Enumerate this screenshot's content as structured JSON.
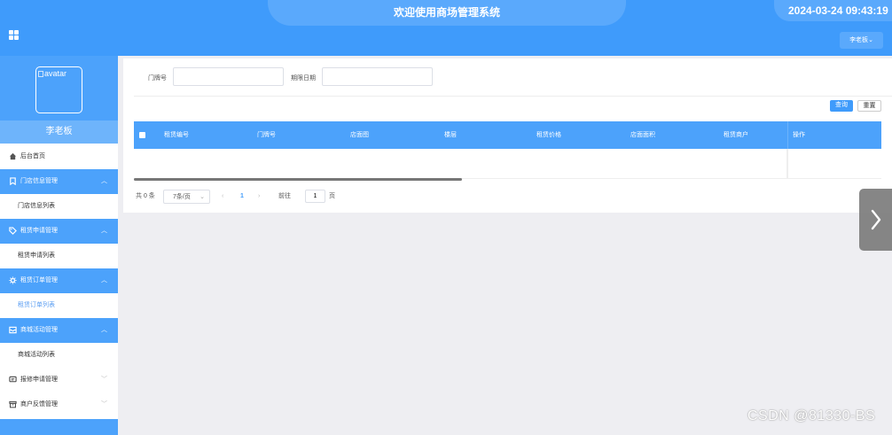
{
  "header": {
    "title": "欢迎使用商场管理系统",
    "datetime": "2024-03-24 09:43:19",
    "user_button_label": "李老板"
  },
  "sidebar": {
    "avatar_alt": "avatar",
    "username": "李老板",
    "items": [
      {
        "label": "后台首页",
        "icon": "home-icon"
      },
      {
        "label": "门店信息管理",
        "icon": "bookmark-icon",
        "expanded": true,
        "children": [
          "门店信息列表"
        ]
      },
      {
        "label": "租赁申请管理",
        "icon": "tag-icon",
        "expanded": true,
        "children": [
          "租赁申请列表"
        ]
      },
      {
        "label": "租赁订单管理",
        "icon": "gear-icon",
        "expanded": true,
        "children": [
          "租赁订单列表"
        ]
      },
      {
        "label": "商城活动管理",
        "icon": "inbox-icon",
        "expanded": true,
        "children": [
          "商城活动列表"
        ]
      },
      {
        "label": "报修申请管理",
        "icon": "message-icon",
        "expanded": false
      },
      {
        "label": "商户反馈管理",
        "icon": "archive-icon",
        "expanded": false
      }
    ],
    "active_submenu": "租赁订单列表"
  },
  "search": {
    "door_label": "门牌号",
    "door_value": "",
    "date_label": "期限日期",
    "date_value": "",
    "query_label": "查询",
    "reset_label": "重置"
  },
  "table": {
    "columns": [
      "租赁编号",
      "门牌号",
      "店面图",
      "楼层",
      "租赁价格",
      "店面面积",
      "租赁商户",
      "操作"
    ],
    "rows": []
  },
  "pagination": {
    "total_text": "共 0 条",
    "page_size": "7条/页",
    "current_page": "1",
    "goto_label": "前往",
    "goto_value": "1",
    "page_unit": "页"
  },
  "watermark": "CSDN @81330-BS",
  "colors": {
    "primary": "#3f9bfb",
    "sidebar_group": "#4ca2fb",
    "active_text": "#5b9ef2"
  }
}
